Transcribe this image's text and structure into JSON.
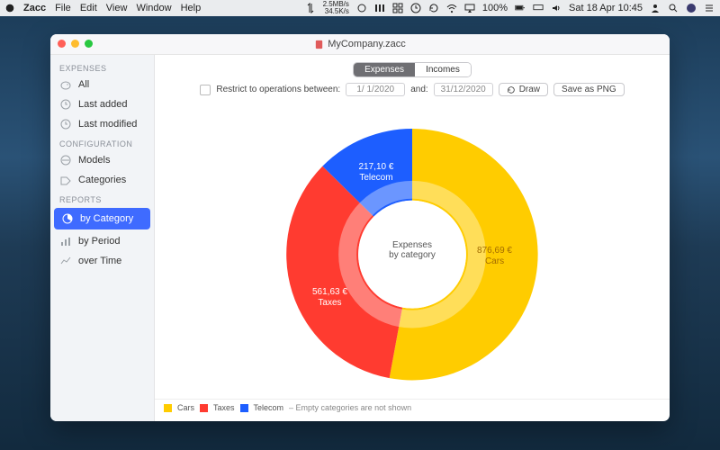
{
  "menubar": {
    "app": "Zacc",
    "items": [
      "File",
      "Edit",
      "View",
      "Window",
      "Help"
    ],
    "right": {
      "net_up": "2.5MB/s",
      "net_down": "34.5K/s",
      "battery": "100%",
      "datetime": "Sat 18 Apr  10:45"
    }
  },
  "window": {
    "title": "MyCompany.zacc"
  },
  "sidebar": {
    "sections": [
      {
        "title": "EXPENSES",
        "items": [
          "All",
          "Last added",
          "Last modified"
        ]
      },
      {
        "title": "CONFIGURATION",
        "items": [
          "Models",
          "Categories"
        ]
      },
      {
        "title": "REPORTS",
        "items": [
          "by Category",
          "by Period",
          "over Time"
        ]
      }
    ]
  },
  "main": {
    "tabs": [
      "Expenses",
      "Incomes"
    ],
    "filter": {
      "label": "Restrict to operations between:",
      "from": "1/  1/2020",
      "and": "and:",
      "to": "31/12/2020"
    },
    "buttons": {
      "draw": "Draw",
      "save_png": "Save as PNG"
    },
    "chart": {
      "center_line1": "Expenses",
      "center_line2": "by category"
    },
    "legend": {
      "note": "  – Empty categories are not shown"
    }
  },
  "chart_data": {
    "type": "pie",
    "title": "Expenses by category",
    "series": [
      {
        "name": "Cars",
        "value": 876.69,
        "value_label": "876,69 €",
        "color": "#ffcc00"
      },
      {
        "name": "Taxes",
        "value": 561.63,
        "value_label": "561,63 €",
        "color": "#ff3b30"
      },
      {
        "name": "Telecom",
        "value": 217.1,
        "value_label": "217,10 €",
        "color": "#1d5eff"
      }
    ]
  }
}
